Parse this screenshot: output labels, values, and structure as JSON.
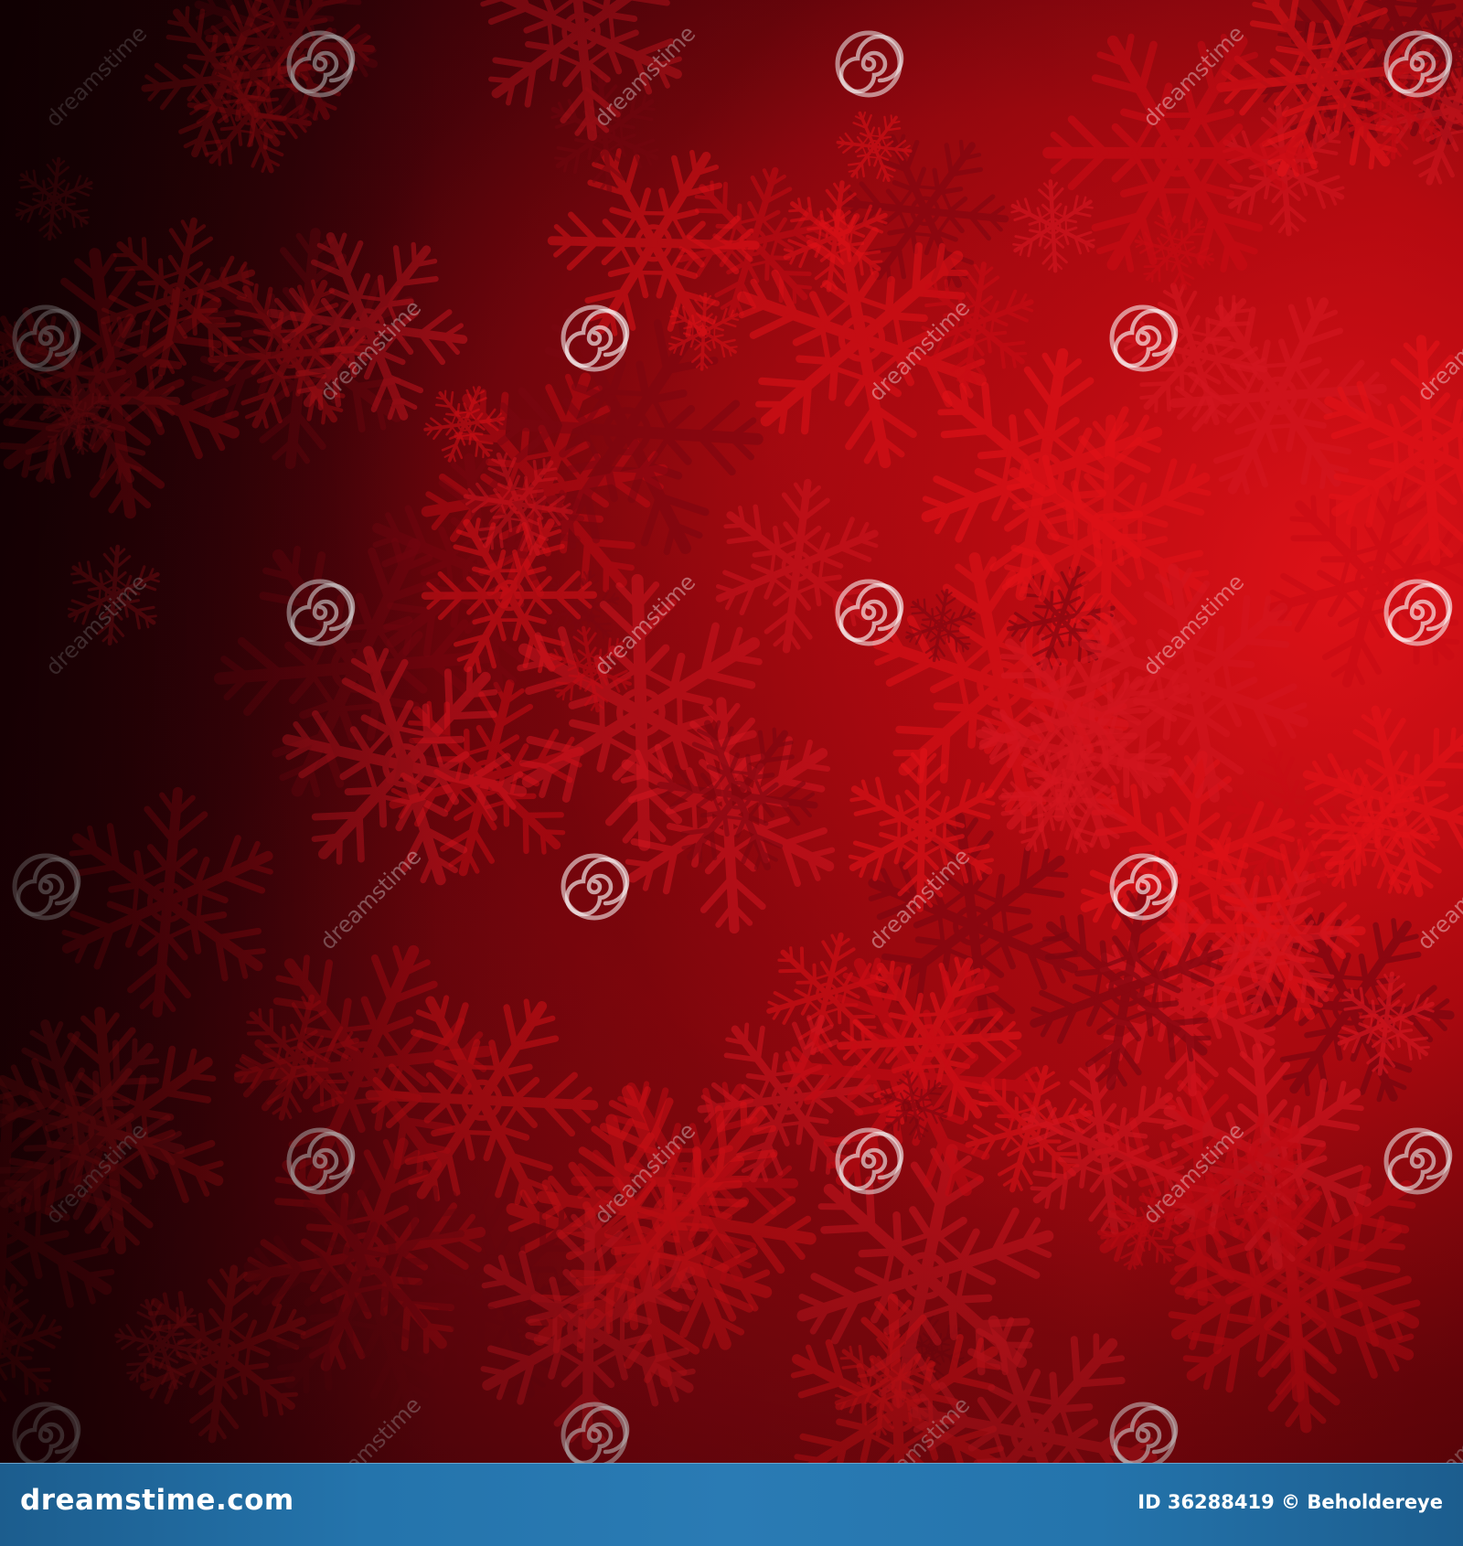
{
  "image": {
    "subject": "red-snowflake-pattern",
    "palette": {
      "deep": "#1a0104",
      "dark": "#40020a",
      "mid": "#7a0610",
      "bright": "#c90b14",
      "hot": "#e21218",
      "flake": "#d41620"
    }
  },
  "watermark": {
    "text": "dreamstime",
    "icon": "dreamstime-spiral-icon"
  },
  "footer": {
    "site": "dreamstime.com",
    "id_label": "ID 36288419",
    "copyright": "©",
    "author": "Beholdereye",
    "bar_color": "#2474ac"
  }
}
